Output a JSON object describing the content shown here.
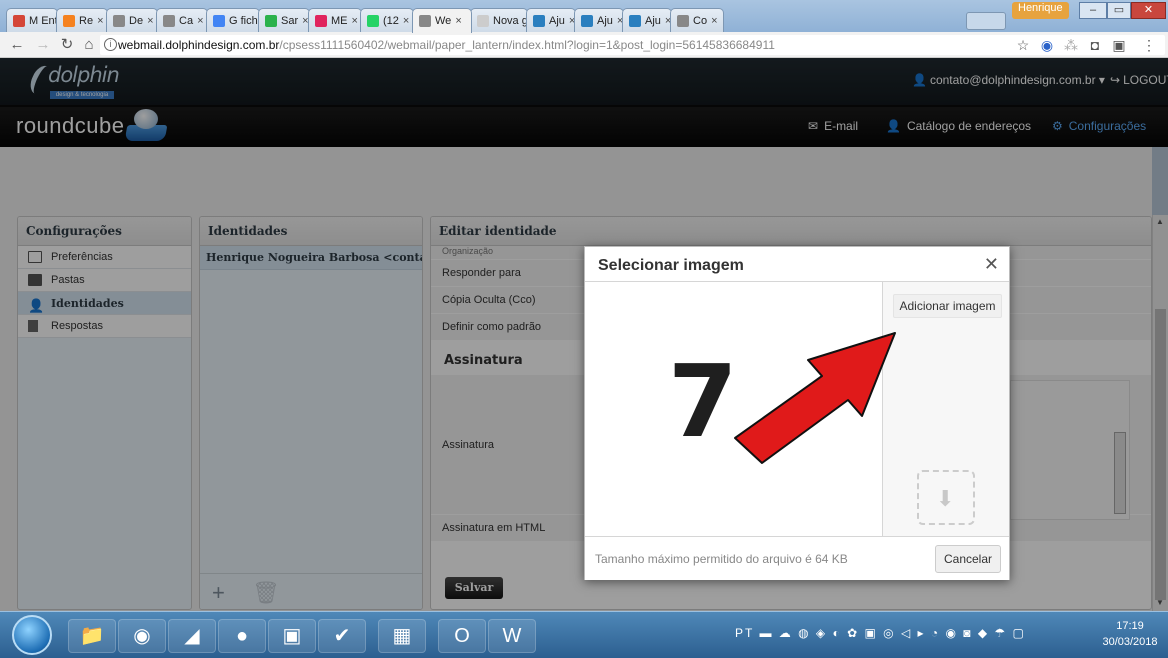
{
  "browser": {
    "tabs": [
      {
        "label": "M Ent",
        "color": "#d44638"
      },
      {
        "label": "Re",
        "color": "#f58220"
      },
      {
        "label": "De",
        "color": "#888888"
      },
      {
        "label": "Ca",
        "color": "#888888"
      },
      {
        "label": "G fich",
        "color": "#4285f4"
      },
      {
        "label": "Sar",
        "color": "#2bb24c"
      },
      {
        "label": "ME",
        "color": "#e0245e"
      },
      {
        "label": "(12",
        "color": "#25d366"
      },
      {
        "label": "We",
        "color": "#888888",
        "active": true
      },
      {
        "label": "Nova g",
        "color": "#cccccc"
      },
      {
        "label": "Aju",
        "color": "#2a7fbf"
      },
      {
        "label": "Aju",
        "color": "#2a7fbf"
      },
      {
        "label": "Aju",
        "color": "#2a7fbf"
      },
      {
        "label": "Co",
        "color": "#888888"
      }
    ],
    "user_label": "Henrique",
    "url_host": "webmail.dolphindesign.com.br",
    "url_path": "/cpsess1111560402/webmail/paper_lantern/index.html?login=1&post_login=56145836684911"
  },
  "topbar": {
    "logo_text": "dolphin",
    "logo_tag": "design & tecnologia",
    "user_email": "contato@dolphindesign.com.br",
    "logout": "LOGOUT"
  },
  "header": {
    "logo": "roundcube",
    "nav": [
      "E-mail",
      "Catálogo de endereços",
      "Configurações"
    ]
  },
  "settings": {
    "title": "Configurações",
    "items": [
      "Preferências",
      "Pastas",
      "Identidades",
      "Respostas"
    ]
  },
  "identities": {
    "title": "Identidades",
    "rows": [
      "Henrique Nogueira Barbosa <contato..."
    ]
  },
  "editor": {
    "title": "Editar identidade",
    "partial_row": "Organização",
    "rows": [
      "Responder para",
      "Cópia Oculta (Cco)",
      "Definir como padrão"
    ],
    "section": "Assinatura",
    "sig_label": "Assinatura",
    "sig_html_label": "Assinatura em HTML",
    "save": "Salvar"
  },
  "dialog": {
    "title": "Selecionar imagem",
    "add_button": "Adicionar imagem",
    "max_size": "Tamanho máximo permitido do arquivo é 64 KB",
    "cancel": "Cancelar"
  },
  "annotation": {
    "step": "7",
    "arrow_color": "#e01a1a"
  },
  "taskbar": {
    "lang": "PT",
    "time": "17:19",
    "date": "30/03/2018"
  }
}
